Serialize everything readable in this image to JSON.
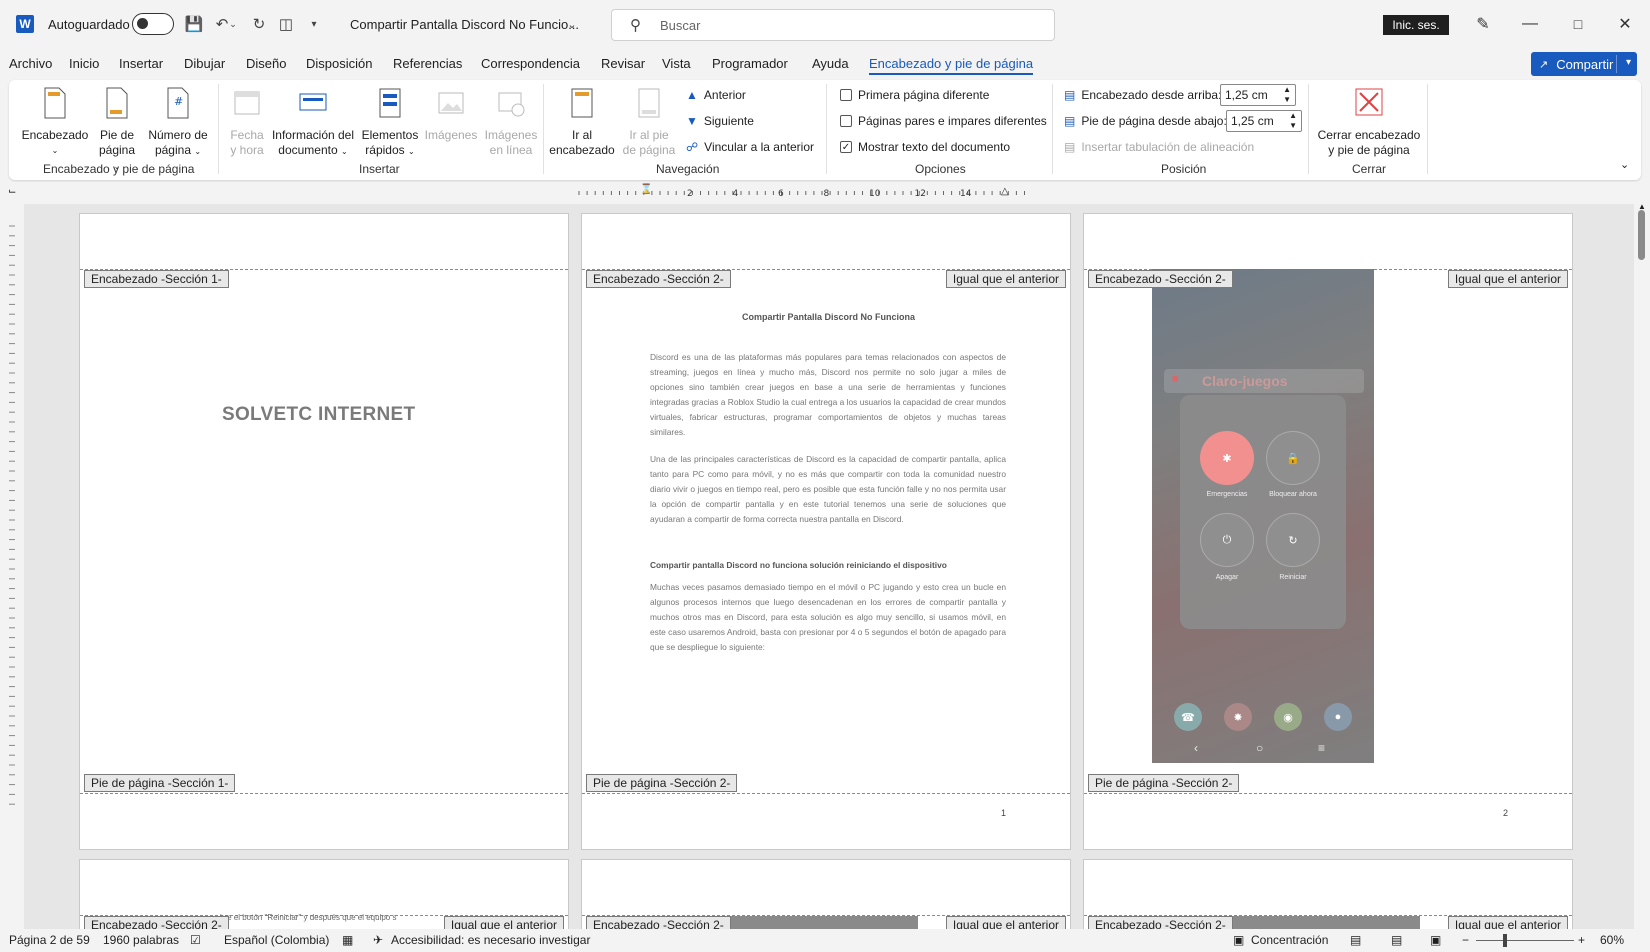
{
  "titlebar": {
    "autosave_label": "Autoguardado",
    "doc_title": "Compartir Pantalla Discord No Funcio...",
    "search_placeholder": "Buscar",
    "signin_label": "Inic. ses."
  },
  "menu": {
    "tabs": [
      "Archivo",
      "Inicio",
      "Insertar",
      "Dibujar",
      "Diseño",
      "Disposición",
      "Referencias",
      "Correspondencia",
      "Revisar",
      "Vista",
      "Programador",
      "Ayuda",
      "Encabezado y pie de página"
    ],
    "active": "Encabezado y pie de página",
    "share_label": "Compartir"
  },
  "ribbon": {
    "group1": {
      "label": "Encabezado y pie de página",
      "encabezado": "Encabezado",
      "pie_1": "Pie de",
      "pie_2": "página",
      "numero_1": "Número de",
      "numero_2": "página"
    },
    "group2": {
      "label": "Insertar",
      "fecha_1": "Fecha",
      "fecha_2": "y hora",
      "info_1": "Información del",
      "info_2": "documento",
      "elementos_1": "Elementos",
      "elementos_2": "rápidos",
      "imagenes": "Imágenes",
      "imagenes_linea_1": "Imágenes",
      "imagenes_linea_2": "en línea"
    },
    "group3": {
      "label": "Navegación",
      "ir_enc_1": "Ir al",
      "ir_enc_2": "encabezado",
      "ir_pie_1": "Ir al pie",
      "ir_pie_2": "de página",
      "anterior": "Anterior",
      "siguiente": "Siguiente",
      "vincular": "Vincular a la anterior"
    },
    "group4": {
      "label": "Opciones",
      "primera": "Primera página diferente",
      "pares": "Páginas pares e impares diferentes",
      "mostrar": "Mostrar texto del documento"
    },
    "group5": {
      "label": "Posición",
      "enc_desde": "Encabezado desde arriba:",
      "enc_valor": "1,25 cm",
      "pie_desde": "Pie de página desde abajo:",
      "pie_valor": "1,25 cm",
      "tabulacion": "Insertar tabulación de alineación"
    },
    "group6": {
      "label": "Cerrar",
      "cerrar_1": "Cerrar encabezado",
      "cerrar_2": "y pie de página"
    }
  },
  "ruler": {
    "labels": [
      "2",
      "4",
      "6",
      "8",
      "10",
      "12",
      "14"
    ]
  },
  "pages": {
    "p1": {
      "header_tag": "Encabezado -Sección 1-",
      "footer_tag": "Pie de página -Sección 1-",
      "brand": "SOLVETC INTERNET"
    },
    "p2": {
      "header_tag": "Encabezado -Sección 2-",
      "same_tag": "Igual que el anterior",
      "footer_tag": "Pie de página -Sección 2-",
      "title": "Compartir Pantalla Discord No Funciona",
      "para1": "Discord es una de las plataformas más populares para temas relacionados con aspectos de streaming, juegos en línea y mucho más, Discord nos permite no solo jugar a miles de opciones sino también crear juegos en base a una serie de herramientas y funciones integradas gracias a Roblox Studio la cual entrega a los usuarios la capacidad de crear mundos virtuales, fabricar estructuras, programar comportamientos de objetos y muchas tareas similares.",
      "para2": "Una de las principales características de Discord es la capacidad de compartir pantalla, aplica tanto para PC como para móvil, y no es más que compartir con toda la comunidad nuestro diario vivir o juegos en tiempo real, pero es posible que esta función falle y no nos permita usar la opción de compartir pantalla y en este tutorial tenemos una serie de soluciones que ayudaran a compartir de forma correcta nuestra pantalla en Discord.",
      "subtitle": "Compartir pantalla Discord no funciona solución reiniciando el dispositivo",
      "para3": "Muchas veces pasamos demasiado tiempo en el móvil o PC jugando y esto crea un bucle en algunos procesos internos que luego desencadenan en los errores de compartir pantalla y muchos otros mas en Discord, para esta solución es algo muy sencillo, si usamos móvil, en este caso usaremos Android, basta con presionar por 4 o 5 segundos el botón de apagado para que se despliegue lo siguiente:",
      "page_number": "1"
    },
    "p3": {
      "header_tag": "Encabezado -Sección 2-",
      "same_tag": "Igual que el anterior",
      "footer_tag": "Pie de página -Sección 2-",
      "page_number": "2",
      "phone": {
        "app_title": "Claro-juegos",
        "emergencias": "Emergencias",
        "bloquear": "Bloquear ahora",
        "apagar": "Apagar",
        "reiniciar": "Reiniciar"
      }
    },
    "row2": {
      "p4_header": "Encabezado -Sección 2-",
      "p4_same": "Igual que el anterior",
      "p4_snippet": "bre el botón \"Reiniciar\" y después que el equipo s",
      "p5_header": "Encabezado -Sección 2-",
      "p5_same": "Igual que el anterior",
      "p6_header": "Encabezado -Sección 2-",
      "p6_same": "Igual que el anterior"
    }
  },
  "status": {
    "page": "Página 2 de 59",
    "words": "1960 palabras",
    "language": "Español (Colombia)",
    "accessibility": "Accesibilidad: es necesario investigar",
    "focus": "Concentración",
    "zoom": "60%"
  },
  "colors": {
    "accent": "#185abd",
    "close_icon": "#e04040"
  }
}
